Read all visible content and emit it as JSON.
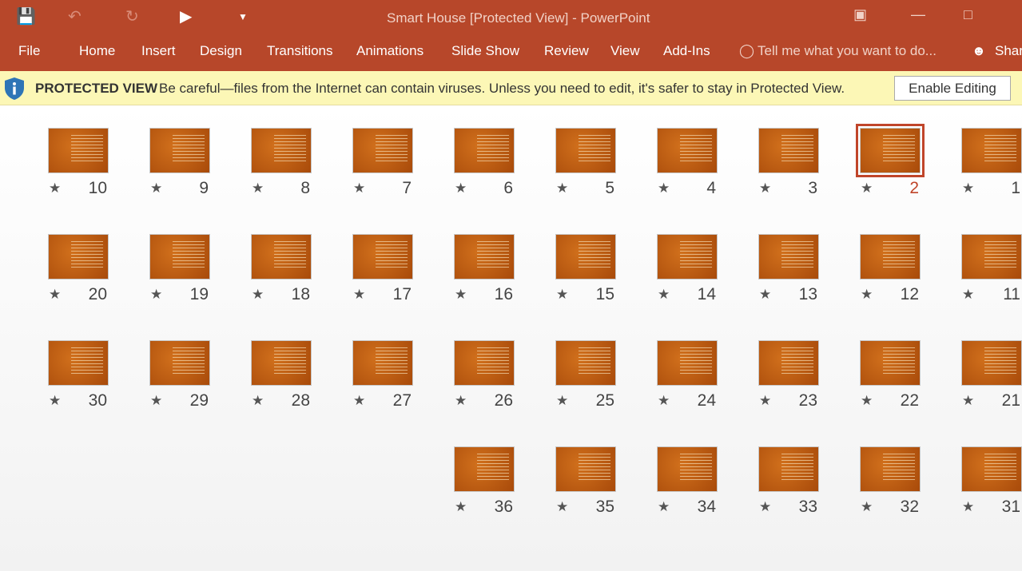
{
  "titlebar": {
    "title": "Smart House [Protected View] - PowerPoint",
    "icons": [
      "save-icon",
      "undo-icon",
      "redo-icon",
      "start-from-beginning-icon",
      "customize-qat-icon"
    ]
  },
  "ribbon": {
    "tabs": [
      "File",
      "Home",
      "Insert",
      "Design",
      "Transitions",
      "Animations",
      "Slide Show",
      "Review",
      "View",
      "Add-Ins"
    ],
    "tell_me": "Tell me what you want to do...",
    "share": "Share"
  },
  "protected_view": {
    "heading": "PROTECTED VIEW",
    "message": "Be careful—files from the Internet can contain viruses. Unless you need to edit, it's safer to stay in Protected View.",
    "button": "Enable Editing",
    "accent": "#2e75b6"
  },
  "sorter": {
    "selected": 2,
    "accent": "#c0452a",
    "rows": [
      [
        10,
        9,
        8,
        7,
        6,
        5,
        4,
        3,
        2,
        1
      ],
      [
        20,
        19,
        18,
        17,
        16,
        15,
        14,
        13,
        12,
        11
      ],
      [
        30,
        29,
        28,
        27,
        26,
        25,
        24,
        23,
        22,
        21
      ],
      [
        null,
        null,
        null,
        null,
        36,
        35,
        34,
        33,
        32,
        31
      ]
    ]
  }
}
